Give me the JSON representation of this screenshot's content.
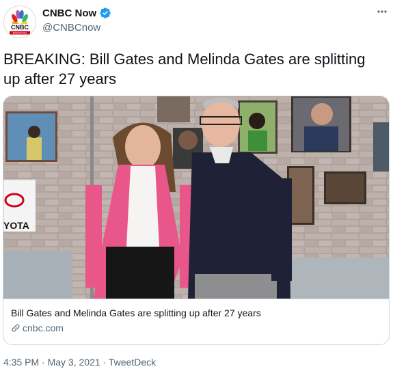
{
  "account": {
    "display_name": "CNBC Now",
    "handle": "@CNBCnow",
    "avatar_text": "CNBC",
    "avatar_subtext": "BREAKING",
    "verified": true
  },
  "tweet": {
    "text": "BREAKING:  Bill Gates and Melinda Gates are splitting up after 27 years"
  },
  "card": {
    "title": "Bill Gates and Melinda Gates are splitting up after 27 years",
    "domain": "cnbc.com",
    "image_sign_text": "YOTA"
  },
  "meta": {
    "time": "4:35 PM",
    "date": "May 3, 2021",
    "source": "TweetDeck",
    "separator": "·"
  },
  "colors": {
    "verified_blue": "#1d9bf0",
    "cnbc_red": "#d0021b",
    "muted_text": "#536471"
  }
}
